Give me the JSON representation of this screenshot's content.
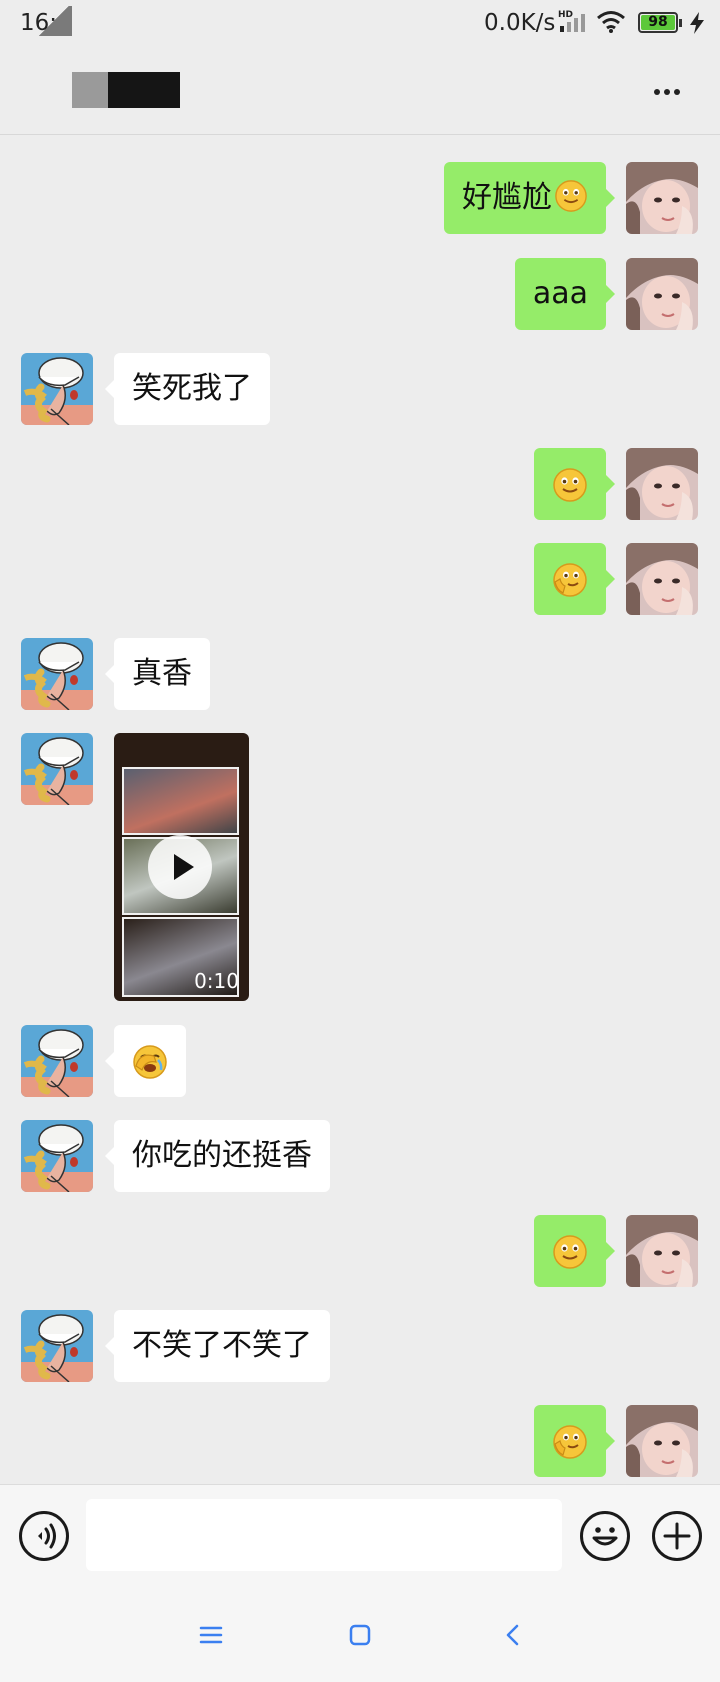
{
  "status_bar": {
    "time": "16:",
    "network_speed": "0.0K/s",
    "network_badge": "HD",
    "battery_level": "98",
    "battery_color": "#5cc83a"
  },
  "header": {
    "title": "",
    "more_icon": "more-horizontal-icon"
  },
  "colors": {
    "background": "#ededed",
    "sent_bubble": "#95ec69",
    "received_bubble": "#ffffff",
    "nav_icon": "#3b7ff0"
  },
  "messages": [
    {
      "side": "right",
      "type": "text",
      "text": "好尴尬",
      "trailing_emoji": "smile-emoji-icon"
    },
    {
      "side": "right",
      "type": "text",
      "text": "aaa"
    },
    {
      "side": "left",
      "type": "text",
      "text": "笑死我了"
    },
    {
      "side": "right",
      "type": "emoji",
      "emoji": "smile-emoji-icon"
    },
    {
      "side": "right",
      "type": "emoji",
      "emoji": "shy-emoji-icon"
    },
    {
      "side": "left",
      "type": "text",
      "text": "真香"
    },
    {
      "side": "left",
      "type": "video",
      "duration": "0:10"
    },
    {
      "side": "left",
      "type": "emoji",
      "emoji": "facepalm-emoji-icon"
    },
    {
      "side": "left",
      "type": "text",
      "text": "你吃的还挺香"
    },
    {
      "side": "right",
      "type": "emoji",
      "emoji": "smile-emoji-icon"
    },
    {
      "side": "left",
      "type": "text",
      "text": "不笑了不笑了"
    },
    {
      "side": "right",
      "type": "emoji",
      "emoji": "shy-emoji-icon"
    }
  ],
  "input_bar": {
    "voice_icon": "voice-icon",
    "input_value": "",
    "emoji_icon": "emoji-icon",
    "plus_icon": "plus-icon"
  },
  "system_nav": {
    "menu_icon": "menu-icon",
    "home_icon": "home-icon",
    "back_icon": "back-icon"
  }
}
